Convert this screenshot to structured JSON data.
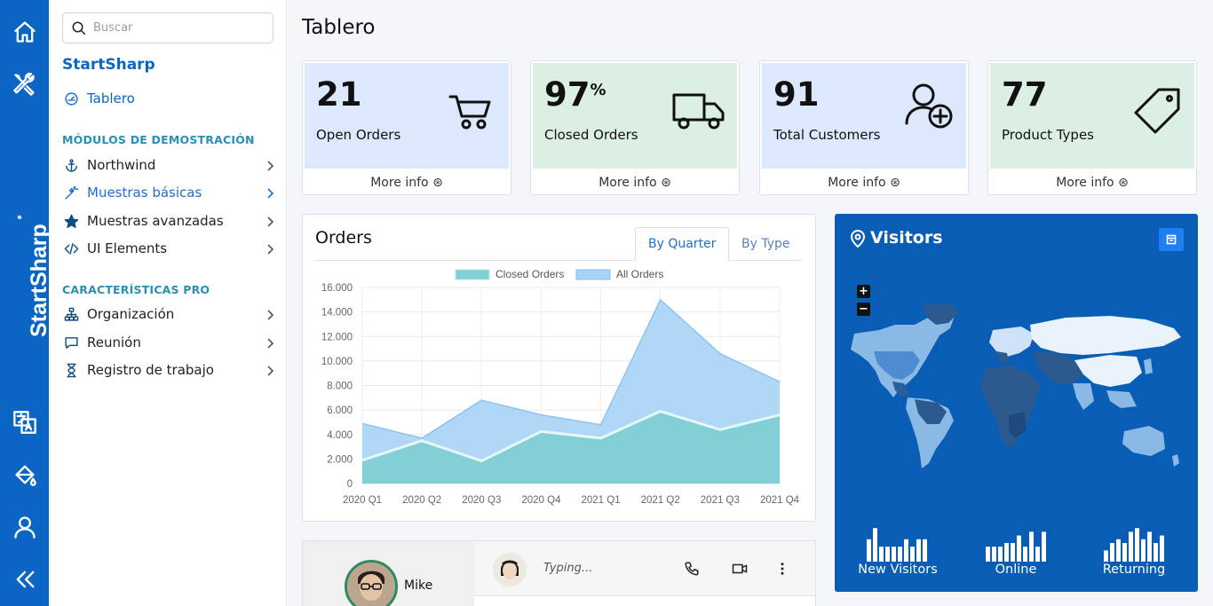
{
  "rail": {
    "brand": "StartSharp",
    "icons": [
      "home-icon",
      "tools-icon",
      "translate-icon",
      "paint-bucket-icon",
      "user-icon",
      "collapse-icon"
    ]
  },
  "sidebar": {
    "search_placeholder": "Buscar",
    "app_name": "StartSharp",
    "dashboard_label": "Tablero",
    "section_demo": "MÓDULOS DE DEMOSTRACIÓN",
    "demo_items": [
      {
        "label": "Northwind",
        "icon": "anchor-icon"
      },
      {
        "label": "Muestras básicas",
        "icon": "magic-wand-icon"
      },
      {
        "label": "Muestras avanzadas",
        "icon": "star-icon"
      },
      {
        "label": "UI Elements",
        "icon": "code-icon"
      }
    ],
    "section_pro": "CARACTERÍSTICAS PRO",
    "pro_items": [
      {
        "label": "Organización",
        "icon": "sitemap-icon"
      },
      {
        "label": "Reunión",
        "icon": "chat-icon"
      },
      {
        "label": "Registro de trabajo",
        "icon": "hourglass-icon"
      }
    ]
  },
  "page": {
    "title": "Tablero"
  },
  "stats": [
    {
      "value": "21",
      "suffix": "",
      "label": "Open Orders",
      "more": "More info",
      "icon": "cart-icon",
      "color": "#dce8fb"
    },
    {
      "value": "97",
      "suffix": "%",
      "label": "Closed Orders",
      "more": "More info",
      "icon": "truck-icon",
      "color": "#dcefe3"
    },
    {
      "value": "91",
      "suffix": "",
      "label": "Total Customers",
      "more": "More info",
      "icon": "user-add-icon",
      "color": "#dce8fb"
    },
    {
      "value": "77",
      "suffix": "",
      "label": "Product Types",
      "more": "More info",
      "icon": "tag-icon",
      "color": "#dcefe3"
    }
  ],
  "orders": {
    "title": "Orders",
    "tabs": [
      "By Quarter",
      "By Type"
    ],
    "active_tab": "By Quarter"
  },
  "chart_data": {
    "type": "area",
    "categories": [
      "2020 Q1",
      "2020 Q2",
      "2020 Q3",
      "2020 Q4",
      "2021 Q1",
      "2021 Q2",
      "2021 Q3",
      "2021 Q4"
    ],
    "series": [
      {
        "name": "Closed Orders",
        "values": [
          1900,
          3500,
          1850,
          4250,
          3700,
          5900,
          4400,
          5600
        ],
        "color": "#7fcfd4"
      },
      {
        "name": "All Orders",
        "values": [
          4900,
          3700,
          6800,
          5600,
          4800,
          15000,
          10600,
          8300
        ],
        "color": "#a9d3f6"
      }
    ],
    "yticks": [
      "16.000",
      "14.000",
      "12.000",
      "10.000",
      "8.000",
      "6.000",
      "4.000",
      "2.000",
      "0"
    ],
    "ylim": [
      0,
      16000
    ],
    "legend": "top",
    "grid": true
  },
  "visitors": {
    "title": "Visitors",
    "zoom_in": "+",
    "zoom_out": "−",
    "sparklines": [
      {
        "label": "New Visitors",
        "values": [
          6,
          9,
          4,
          4,
          4,
          4,
          6,
          4,
          6,
          6
        ]
      },
      {
        "label": "Online",
        "values": [
          4,
          4,
          4,
          5,
          5,
          7,
          4,
          8,
          4,
          8
        ]
      },
      {
        "label": "Returning",
        "values": [
          3,
          5,
          6,
          5,
          8,
          9,
          6,
          8,
          5,
          7
        ]
      }
    ]
  },
  "chat": {
    "contact_name": "Mike",
    "status": "Typing..."
  }
}
